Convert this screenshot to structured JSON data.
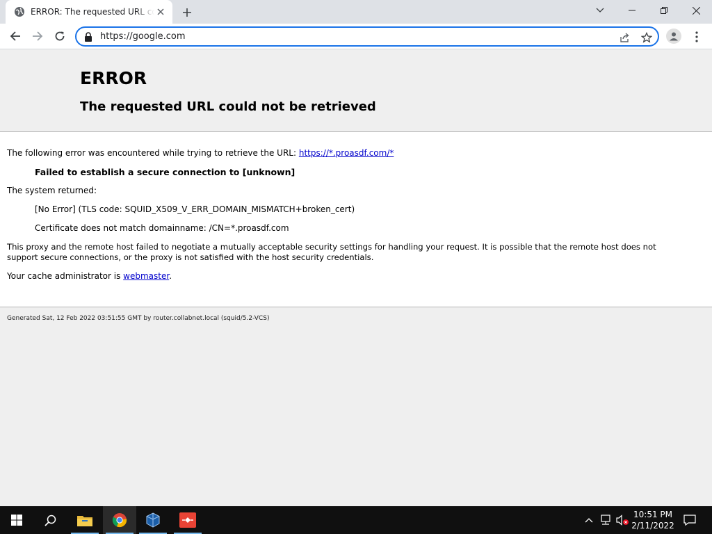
{
  "browser": {
    "tab_title": "ERROR: The requested URL could not be retrieved",
    "url": "https://google.com",
    "accent_color": "#1a73e8"
  },
  "page": {
    "heading": "ERROR",
    "subheading": "The requested URL could not be retrieved",
    "intro_text": "The following error was encountered while trying to retrieve the URL: ",
    "intro_link": "https://*.proasdf.com/*",
    "failure": "Failed to establish a secure connection to [unknown]",
    "system_returned": "The system returned:",
    "tls_code": "[No Error] (TLS code: SQUID_X509_V_ERR_DOMAIN_MISMATCH+broken_cert)",
    "cert_msg": "Certificate does not match domainname: /CN=*.proasdf.com",
    "explanation_line1": "This proxy and the remote host failed to negotiate a mutually acceptable security settings for handling your request. It is possible that the remote host does not",
    "explanation_line2": "support secure connections, or the proxy is not satisfied with the host security credentials.",
    "admin_prefix": "Your cache administrator is ",
    "admin_link": "webmaster",
    "admin_suffix": ".",
    "footer": "Generated Sat, 12 Feb 2022 03:51:55 GMT by router.collabnet.local (squid/5.2-VCS)"
  },
  "taskbar": {
    "apps": [
      "windows-start-icon",
      "search-icon",
      "file-explorer-icon",
      "chrome-icon",
      "virtualbox-icon",
      "git-icon"
    ],
    "time": "10:51 PM",
    "date": "2/11/2022"
  }
}
